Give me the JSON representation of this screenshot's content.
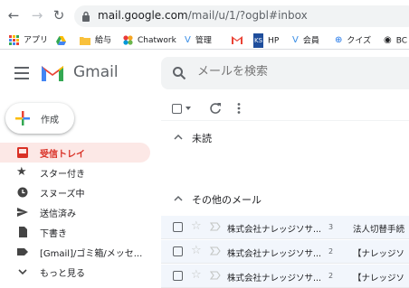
{
  "browser": {
    "url_host": "mail.google.com",
    "url_path": "/mail/u/1/?ogbl#inbox",
    "bookmarks": [
      "アプリ",
      "給与",
      "Chatwork",
      "管理",
      "HP",
      "会員",
      "クイズ",
      "BC"
    ]
  },
  "header": {
    "app_name": "Gmail",
    "search_placeholder": "メールを検索"
  },
  "sidebar": {
    "compose_label": "作成",
    "items": [
      {
        "label": "受信トレイ",
        "icon": "inbox-icon",
        "active": true
      },
      {
        "label": "スター付き",
        "icon": "star-icon"
      },
      {
        "label": "スヌーズ中",
        "icon": "clock-icon"
      },
      {
        "label": "送信済み",
        "icon": "send-icon"
      },
      {
        "label": "下書き",
        "icon": "draft-icon"
      },
      {
        "label": "[Gmail]/ゴミ箱/メッセ...",
        "icon": "label-icon"
      },
      {
        "label": "もっと見る",
        "icon": "chevron-down-icon"
      }
    ]
  },
  "main": {
    "sections": [
      "未読",
      "その他のメール"
    ],
    "emails": [
      {
        "sender": "株式会社ナレッジソサ...",
        "count": "3",
        "subject": "法人切替手続"
      },
      {
        "sender": "株式会社ナレッジソサ...",
        "count": "2",
        "subject": "【ナレッジソ"
      },
      {
        "sender": "株式会社ナレッジソサ...",
        "count": "2",
        "subject": "【ナレッジソ"
      }
    ]
  },
  "colors": {
    "active_bg": "#fce8e6",
    "active_text": "#d93025",
    "accent_red": "#ea4335"
  }
}
